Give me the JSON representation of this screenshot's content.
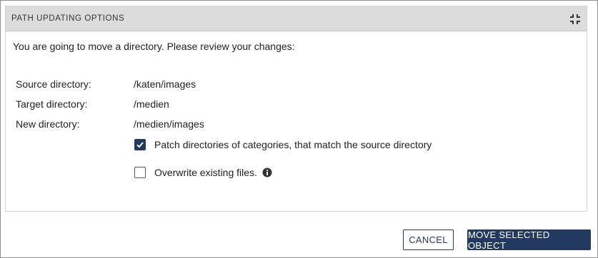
{
  "dialog": {
    "title": "PATH UPDATING OPTIONS",
    "collapse_icon": "collapse-icon",
    "intro": "You are going to move a directory. Please review your changes:"
  },
  "details": [
    {
      "label": "Source directory:",
      "value": "/katen/images"
    },
    {
      "label": "Target directory:",
      "value": "/medien"
    },
    {
      "label": "New directory:",
      "value": "/medien/images"
    }
  ],
  "options": [
    {
      "label": "Patch directories of categories, that match the source directory",
      "checked": true
    },
    {
      "label": "Overwrite existing files.",
      "checked": false,
      "icon": "info-icon"
    }
  ],
  "buttons": {
    "cancel": "CANCEL",
    "move": "MOVE SELECTED OBJECT"
  },
  "colors": {
    "primary": "#233a60",
    "header_bg": "#dcdcdc"
  }
}
